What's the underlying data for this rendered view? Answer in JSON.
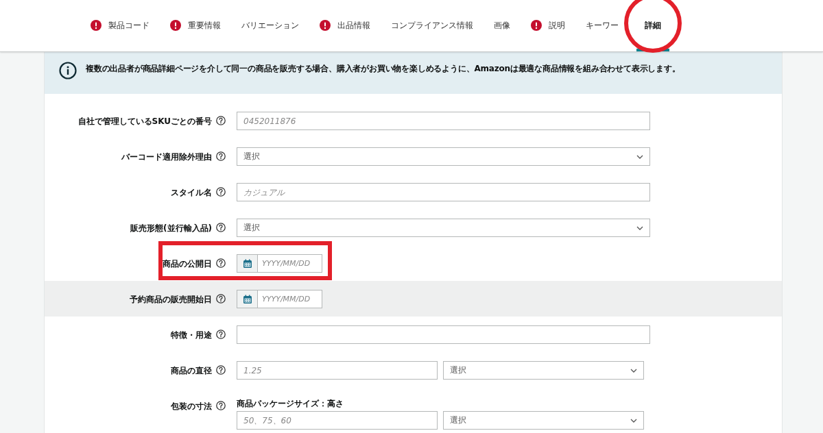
{
  "tabs": [
    {
      "label": "製品コード",
      "alert": true,
      "selected": false,
      "circled": false
    },
    {
      "label": "重要情報",
      "alert": true,
      "selected": false,
      "circled": false
    },
    {
      "label": "バリエーション",
      "alert": false,
      "selected": false,
      "circled": false
    },
    {
      "label": "出品情報",
      "alert": true,
      "selected": false,
      "circled": false
    },
    {
      "label": "コンプライアンス情報",
      "alert": false,
      "selected": false,
      "circled": false
    },
    {
      "label": "画像",
      "alert": false,
      "selected": false,
      "circled": false
    },
    {
      "label": "説明",
      "alert": true,
      "selected": false,
      "circled": false
    },
    {
      "label": "キーワー",
      "alert": false,
      "selected": false,
      "circled": false
    },
    {
      "label": "詳細",
      "alert": false,
      "selected": true,
      "circled": true
    }
  ],
  "notice": "複数の出品者が商品詳細ページを介して同一の商品を販売する場合、購入者がお買い物を楽しめるように、Amazonは最適な商品情報を組み合わせて表示します。",
  "fields": [
    {
      "kind": "text",
      "label": "自社で管理しているSKUごとの番号",
      "placeholder": "0452011876",
      "boxed": false,
      "shaded": false
    },
    {
      "kind": "select",
      "label": "バーコード適用除外理由",
      "placeholder": "選択",
      "boxed": false,
      "shaded": false
    },
    {
      "kind": "text",
      "label": "スタイル名",
      "placeholder": "カジュアル",
      "boxed": false,
      "shaded": false
    },
    {
      "kind": "select",
      "label": "販売形態(並行輸入品)",
      "placeholder": "選択",
      "boxed": false,
      "shaded": false
    },
    {
      "kind": "date",
      "label": "商品の公開日",
      "placeholder": "YYYY/MM/DD",
      "boxed": true,
      "shaded": false
    },
    {
      "kind": "date",
      "label": "予約商品の販売開始日",
      "placeholder": "YYYY/MM/DD",
      "boxed": false,
      "shaded": true
    },
    {
      "kind": "text",
      "label": "特徴・用途",
      "boxed": false,
      "shaded": false
    },
    {
      "kind": "unit",
      "label": "商品の直径",
      "placeholder": "1.25",
      "unit_placeholder": "選択",
      "boxed": false,
      "shaded": false
    },
    {
      "kind": "package",
      "label": "包装の寸法",
      "boxed": false,
      "shaded": false,
      "parts": [
        {
          "sublabel": "商品パッケージサイズ：高さ",
          "placeholder": "50、75、60",
          "unit_placeholder": "選択"
        }
      ]
    }
  ]
}
